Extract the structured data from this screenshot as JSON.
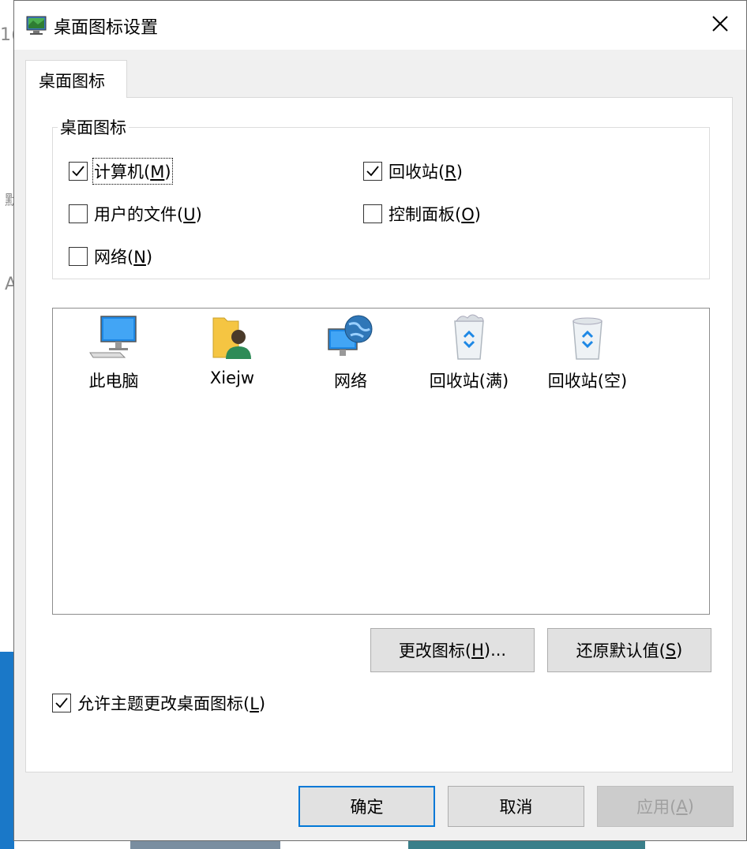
{
  "window": {
    "title": "桌面图标设置",
    "close_icon": "close-icon"
  },
  "tab": {
    "label": "桌面图标"
  },
  "group": {
    "legend": "桌面图标",
    "checkboxes": [
      {
        "label": "计算机(",
        "hotkey": "M",
        "suffix": ")",
        "checked": true
      },
      {
        "label": "回收站(",
        "hotkey": "R",
        "suffix": ")",
        "checked": true
      },
      {
        "label": "用户的文件(",
        "hotkey": "U",
        "suffix": ")",
        "checked": false
      },
      {
        "label": "控制面板(",
        "hotkey": "O",
        "suffix": ")",
        "checked": false
      },
      {
        "label": "网络(",
        "hotkey": "N",
        "suffix": ")",
        "checked": false
      }
    ]
  },
  "icons": [
    {
      "label": "此电脑",
      "icon": "computer-icon"
    },
    {
      "label": "Xiejw",
      "icon": "user-folder-icon"
    },
    {
      "label": "网络",
      "icon": "network-icon"
    },
    {
      "label": "回收站(满)",
      "icon": "recycle-bin-full-icon"
    },
    {
      "label": "回收站(空)",
      "icon": "recycle-bin-empty-icon"
    }
  ],
  "buttons": {
    "change_icon": {
      "label": "更改图标(",
      "hotkey": "H",
      "suffix": ")..."
    },
    "restore_default": {
      "label": "还原默认值(",
      "hotkey": "S",
      "suffix": ")"
    },
    "ok": "确定",
    "cancel": "取消",
    "apply": {
      "label": "应用(",
      "hotkey": "A",
      "suffix": ")"
    }
  },
  "allow_themes": {
    "label": "允许主题更改桌面图标(",
    "hotkey": "L",
    "suffix": ")",
    "checked": true
  },
  "background_fragments": [
    "1(",
    "默",
    "A"
  ],
  "colors": {
    "accent": "#0078d7",
    "dialog_bg": "#f0f0f0"
  }
}
